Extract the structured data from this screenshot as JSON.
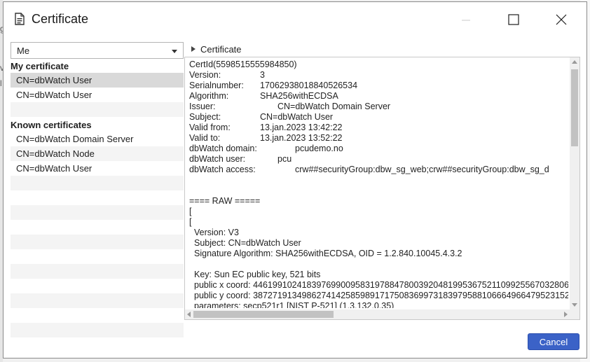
{
  "window": {
    "title": "Certificate"
  },
  "identity_select": {
    "value": "Me"
  },
  "my_certificate": {
    "header": "My certificate",
    "items": [
      "CN=dbWatch User",
      "CN=dbWatch User"
    ]
  },
  "known_certificates": {
    "header": "Known certificates",
    "items": [
      "CN=dbWatch Domain Server",
      "CN=dbWatch Node",
      "CN=dbWatch User"
    ]
  },
  "details": {
    "tree_label": "Certificate",
    "cert_id": "CertId(5598515555984850)",
    "fields": [
      {
        "label": "Version:",
        "value": "3"
      },
      {
        "label": "Serialnumber:",
        "value": "17062938018840526534"
      },
      {
        "label": "Algorithm:",
        "value": "SHA256withECDSA"
      },
      {
        "label": "Issuer:",
        "value": "CN=dbWatch Domain Server"
      },
      {
        "label": "Subject:",
        "value": "CN=dbWatch User"
      },
      {
        "label": "Valid from:",
        "value": "13.jan.2023 13:42:22"
      },
      {
        "label": "Valid to:",
        "value": "13.jan.2023 13:52:22"
      },
      {
        "label": "dbWatch domain:",
        "value": "pcudemo.no"
      },
      {
        "label": "dbWatch user:",
        "value": "pcu"
      },
      {
        "label": "dbWatch access:",
        "value": "crw##securityGroup:dbw_sg_web;crw##securityGroup:dbw_sg_d"
      }
    ],
    "raw": {
      "header": "==== RAW =====",
      "open1": "[",
      "open2": "[",
      "version": "Version: V3",
      "subject": "Subject: CN=dbWatch User",
      "sig_alg": "Signature Algorithm: SHA256withECDSA, OID = 1.2.840.10045.4.3.2",
      "key": "Key:  Sun EC public key, 521 bits",
      "public_x": "public x coord: 44619910241839769900958319788478003920481995367521109925567032806",
      "public_y": "public y coord: 38727191349862741425859891717508369973183979588106664966479523152",
      "parameters": "parameters: secp521r1 [NIST P-521] (1.3.132.0.35)"
    }
  },
  "buttons": {
    "cancel": "Cancel"
  },
  "colors": {
    "accent": "#3b62c7",
    "selected_row": "#d9d9d9"
  }
}
